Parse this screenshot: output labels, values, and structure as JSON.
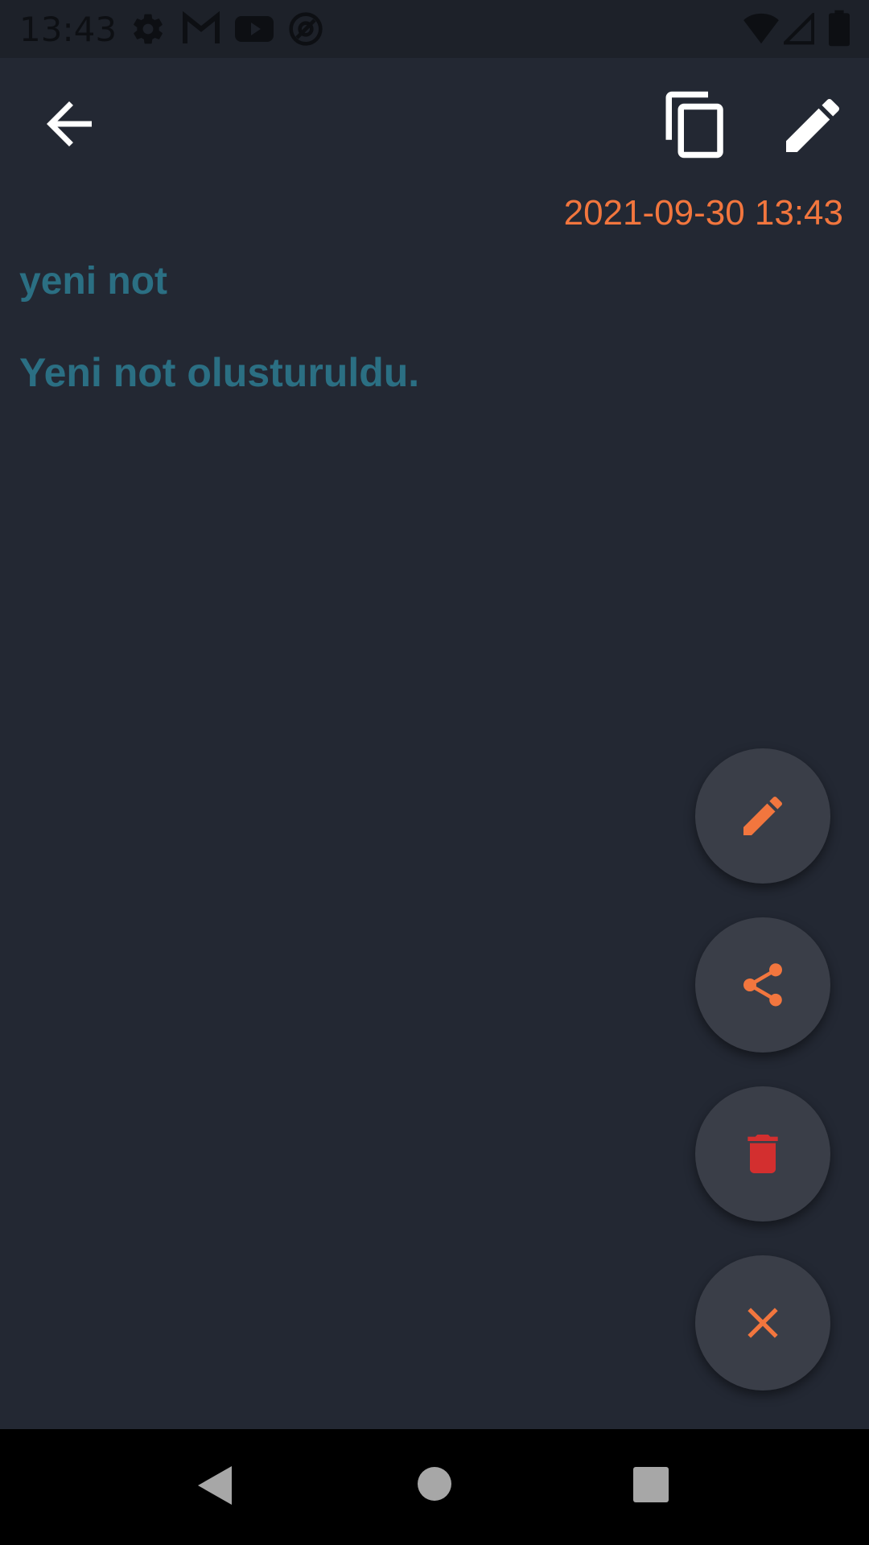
{
  "status_bar": {
    "time": "13:43",
    "icons": [
      "settings-icon",
      "gmail-icon",
      "youtube-icon",
      "at-sign-icon",
      "wifi-icon",
      "signal-icon",
      "battery-icon"
    ]
  },
  "app_bar": {
    "back_icon": "arrow-left-icon",
    "copy_icon": "copy-icon",
    "edit_icon": "pencil-icon"
  },
  "note": {
    "timestamp": "2021-09-30 13:43",
    "title": "yeni not",
    "body": "Yeni not olusturuldu."
  },
  "fab_menu": {
    "items": [
      {
        "icon": "pencil-icon",
        "color": "#f2763e"
      },
      {
        "icon": "share-icon",
        "color": "#f2763e"
      },
      {
        "icon": "trash-icon",
        "color": "#d32f2f"
      },
      {
        "icon": "close-icon",
        "color": "#f2763e"
      }
    ]
  },
  "colors": {
    "background": "#232833",
    "accent": "#f2763e",
    "text": "#2b6f83",
    "fab_bg": "#3a3e48",
    "danger": "#d32f2f"
  },
  "nav_bar": {
    "back": "nav-back-icon",
    "home": "nav-home-icon",
    "recents": "nav-recents-icon"
  }
}
